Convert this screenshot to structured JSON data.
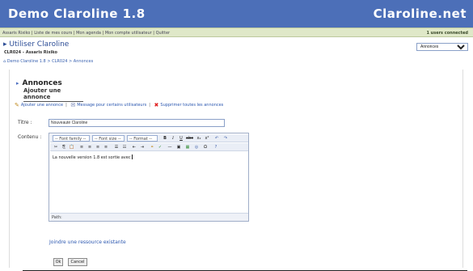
{
  "header": {
    "title": "Demo Claroline 1.8",
    "brand": "Claroline.net"
  },
  "userbar": {
    "links": [
      "Assaris Rixiko",
      "Liste de mes cours",
      "Mon agenda",
      "Mon compte utilisateur",
      "Quitter"
    ],
    "users_connected": "1 users connected"
  },
  "course": {
    "title": "Utiliser Claroline",
    "sub": "CLR024 - Assaris Rixiko",
    "tool_select": "Annonces"
  },
  "breadcrumb": "Demo Claroline 1.8 > CLR024 > Annonces",
  "page": {
    "heading": "Annonces",
    "subheading": "Ajouter une annonce"
  },
  "actions": {
    "add": "Ajouter une annonce",
    "message": "Message pour certains utilisateurs",
    "delete_all": "Supprimer toutes les annonces"
  },
  "form": {
    "title_label": "Titre :",
    "title_value": "Nouveauté Claroline",
    "content_label": "Contenu :",
    "font_family": "-- Font family --",
    "font_size": "-- Font size --",
    "format": "-- Format --",
    "content_text": "La nouvelle version 1.8 est sortie avec",
    "path_label": "Path:",
    "resource_link": "Joindre une ressource existante",
    "ok": "Ok",
    "cancel": "Cancel"
  },
  "colors": {
    "header_bg": "#4c6fb8",
    "userbar_bg": "#dfe8c8",
    "link": "#2c58b0",
    "delete_icon": "#e02020"
  },
  "icons": [
    "pencil-icon",
    "envelope-icon",
    "delete-x-icon",
    "undo-icon",
    "redo-icon",
    "cut-icon",
    "copy-icon",
    "paste-icon",
    "bullet-list-icon",
    "numbered-list-icon",
    "link-icon",
    "image-icon",
    "help-icon"
  ]
}
